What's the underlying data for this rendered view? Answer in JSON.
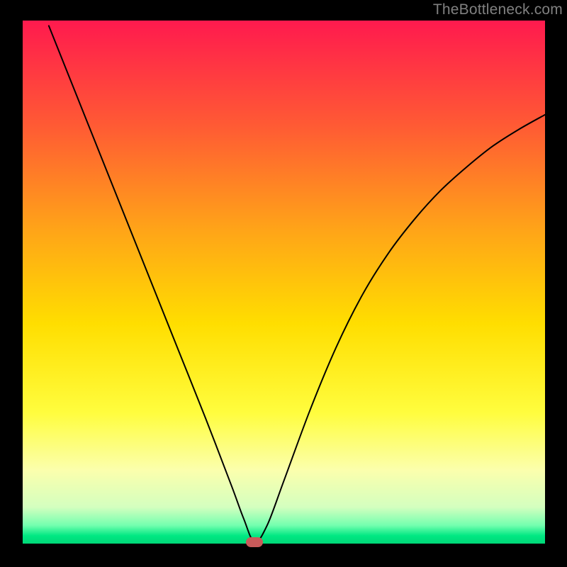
{
  "watermark": "TheBottleneck.com",
  "chart_data": {
    "type": "line",
    "title": "",
    "xlabel": "",
    "ylabel": "",
    "xlim": [
      0,
      100
    ],
    "ylim": [
      0,
      100
    ],
    "grid": false,
    "legend": false,
    "gradient_stops": [
      {
        "offset": 0,
        "color": "#ff1a4e"
      },
      {
        "offset": 0.2,
        "color": "#ff5a34"
      },
      {
        "offset": 0.4,
        "color": "#ffa418"
      },
      {
        "offset": 0.58,
        "color": "#ffde00"
      },
      {
        "offset": 0.75,
        "color": "#fffd3e"
      },
      {
        "offset": 0.86,
        "color": "#fbffad"
      },
      {
        "offset": 0.93,
        "color": "#d4ffbf"
      },
      {
        "offset": 0.965,
        "color": "#74ffaf"
      },
      {
        "offset": 0.985,
        "color": "#00e883"
      },
      {
        "offset": 1.0,
        "color": "#00d877"
      }
    ],
    "series": [
      {
        "name": "bottleneck-curve",
        "color": "#000000",
        "x": [
          5.0,
          10.0,
          15.0,
          20.0,
          25.0,
          30.0,
          35.0,
          40.0,
          42.3,
          44.4,
          46.8,
          50.0,
          55.0,
          60.0,
          65.0,
          70.0,
          75.0,
          80.0,
          85.0,
          90.0,
          95.0,
          100.0
        ],
        "y": [
          99.0,
          86.5,
          74.0,
          61.5,
          49.0,
          36.5,
          24.0,
          11.0,
          4.8,
          0.3,
          3.5,
          12.0,
          25.5,
          37.5,
          47.5,
          55.5,
          62.0,
          67.5,
          72.0,
          76.0,
          79.2,
          82.0
        ]
      }
    ],
    "marker": {
      "name": "bottleneck-min-marker",
      "x": 44.4,
      "y": 0.3,
      "color": "#c85a5a"
    }
  }
}
